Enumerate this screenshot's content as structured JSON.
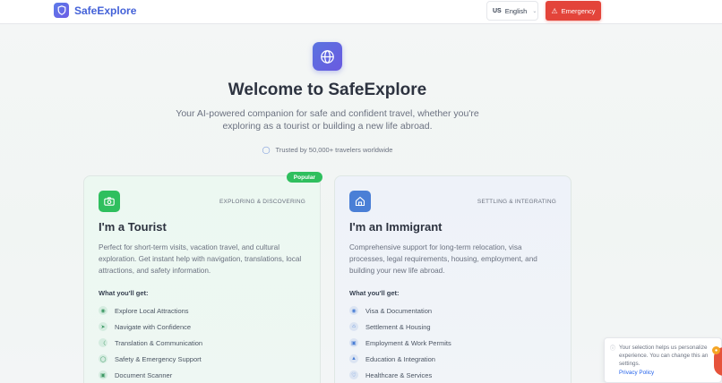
{
  "header": {
    "brand": "SafeExplore",
    "language": {
      "flag": "US",
      "label": "English"
    },
    "emergency_label": "Emergency"
  },
  "hero": {
    "title": "Welcome to SafeExplore",
    "subtitle": "Your AI-powered companion for safe and confident travel, whether you're exploring as a tourist or building a new life abroad.",
    "trust": "Trusted by 50,000+ travelers worldwide"
  },
  "cards": [
    {
      "badge": "Popular",
      "tag": "EXPLORING & DISCOVERING",
      "title": "I'm a Tourist",
      "description": "Perfect for short-term visits, vacation travel, and cultural exploration. Get instant help with navigation, translations, local attractions, and safety information.",
      "get_label": "What you'll get:",
      "features": [
        "Explore Local Attractions",
        "Navigate with Confidence",
        "Translation & Communication",
        "Safety & Emergency Support",
        "Document Scanner"
      ]
    },
    {
      "tag": "SETTLING & INTEGRATING",
      "title": "I'm an Immigrant",
      "description": "Comprehensive support for long-term relocation, visa processes, legal requirements, housing, employment, and building your new life abroad.",
      "get_label": "What you'll get:",
      "features": [
        "Visa & Documentation",
        "Settlement & Housing",
        "Employment & Work Permits",
        "Education & Integration",
        "Healthcare & Services"
      ]
    }
  ],
  "consent": {
    "text": "Your selection helps us personalize experience. You can change this an settings.",
    "policy": "Privacy Policy"
  },
  "colors": {
    "brand": "#4361d8",
    "emergency": "#e3443a",
    "tourist_accent": "#2fbf5e",
    "immigrant_accent": "#4a7fd6"
  }
}
